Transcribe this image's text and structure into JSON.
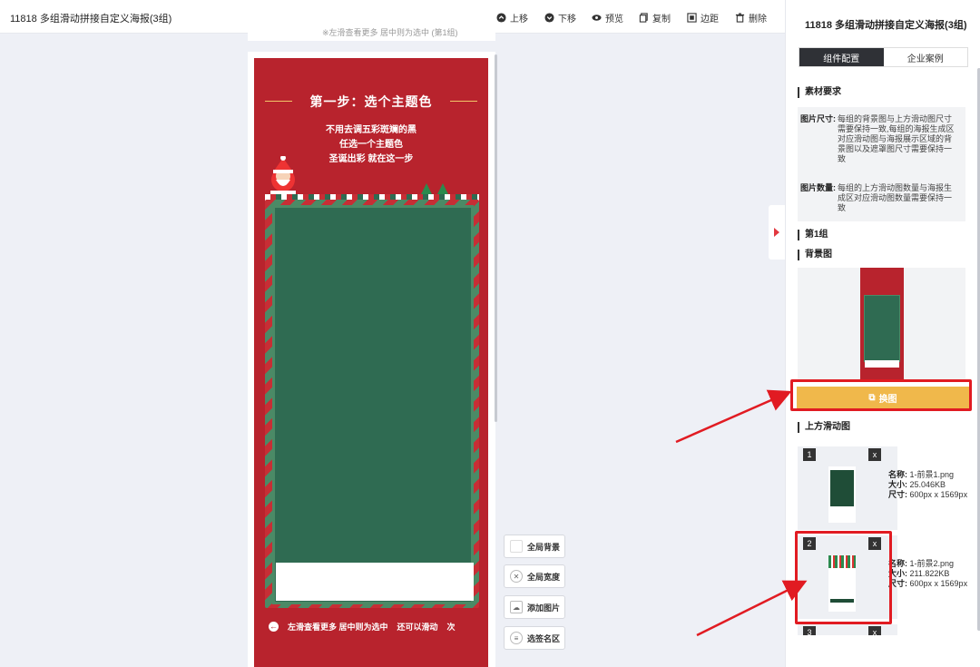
{
  "header": {
    "title": "11818 多组滑动拼接自定义海报(3组)",
    "buttons": [
      {
        "label": "上移",
        "icon": "arrow-up-circle-icon"
      },
      {
        "label": "下移",
        "icon": "arrow-down-circle-icon"
      },
      {
        "label": "预览",
        "icon": "eye-icon"
      },
      {
        "label": "复制",
        "icon": "copy-icon"
      },
      {
        "label": "边距",
        "icon": "margin-icon"
      },
      {
        "label": "删除",
        "icon": "trash-icon"
      }
    ]
  },
  "canvas": {
    "strip_text": "※左滑查看更多 居中则为选中 (第1组)",
    "poster": {
      "step_title": "第一步：选个主题色",
      "lines": [
        "不用去调五彩斑斓的黑",
        "任选一个主题色",
        "圣诞出彩 就在这一步"
      ],
      "footer_left": "左滑查看更多 居中则为选中",
      "footer_mid": "还可以滑动",
      "footer_right": "次"
    }
  },
  "float_tools": [
    {
      "label": "全局背景",
      "icon": "background-icon"
    },
    {
      "label": "全局宽度",
      "icon": "width-icon"
    },
    {
      "label": "添加图片",
      "icon": "image-icon"
    },
    {
      "label": "选签名区",
      "icon": "signature-icon"
    }
  ],
  "panel": {
    "title": "11818 多组滑动拼接自定义海报(3组)",
    "tabs": [
      {
        "label": "组件配置",
        "active": true
      },
      {
        "label": "企业案例",
        "active": false
      }
    ],
    "material_section": "素材要求",
    "requirements": [
      {
        "key": "图片尺寸:",
        "value": "每组的背景图与上方滑动图尺寸需要保持一致,每组的海报生成区对应滑动图与海报展示区域的背景图以及遮罩图尺寸需要保持一致"
      },
      {
        "key": "图片数量:",
        "value": "每组的上方滑动图数量与海报生成区对应滑动图数量需要保持一致"
      }
    ],
    "group_label": "第1组",
    "bg_label": "背景图",
    "swap_button": "换图",
    "slide_label": "上方滑动图",
    "slides": [
      {
        "index": "1",
        "close": "x",
        "name_key": "名称:",
        "name": "1-前景1.png",
        "size_key": "大小:",
        "size": "25.046KB",
        "dim_key": "尺寸:",
        "dim": "600px x 1569px"
      },
      {
        "index": "2",
        "close": "x",
        "name_key": "名称:",
        "name": "1-前景2.png",
        "size_key": "大小:",
        "size": "211.822KB",
        "dim_key": "尺寸:",
        "dim": "600px x 1569px"
      }
    ],
    "slide3_index": "3",
    "slide3_close": "x"
  },
  "colors": {
    "poster_red": "#b8232d",
    "poster_green": "#2f6b52",
    "swap_button": "#f0b84b",
    "highlight_red": "#e11b22",
    "active_tab": "#2f3136"
  }
}
